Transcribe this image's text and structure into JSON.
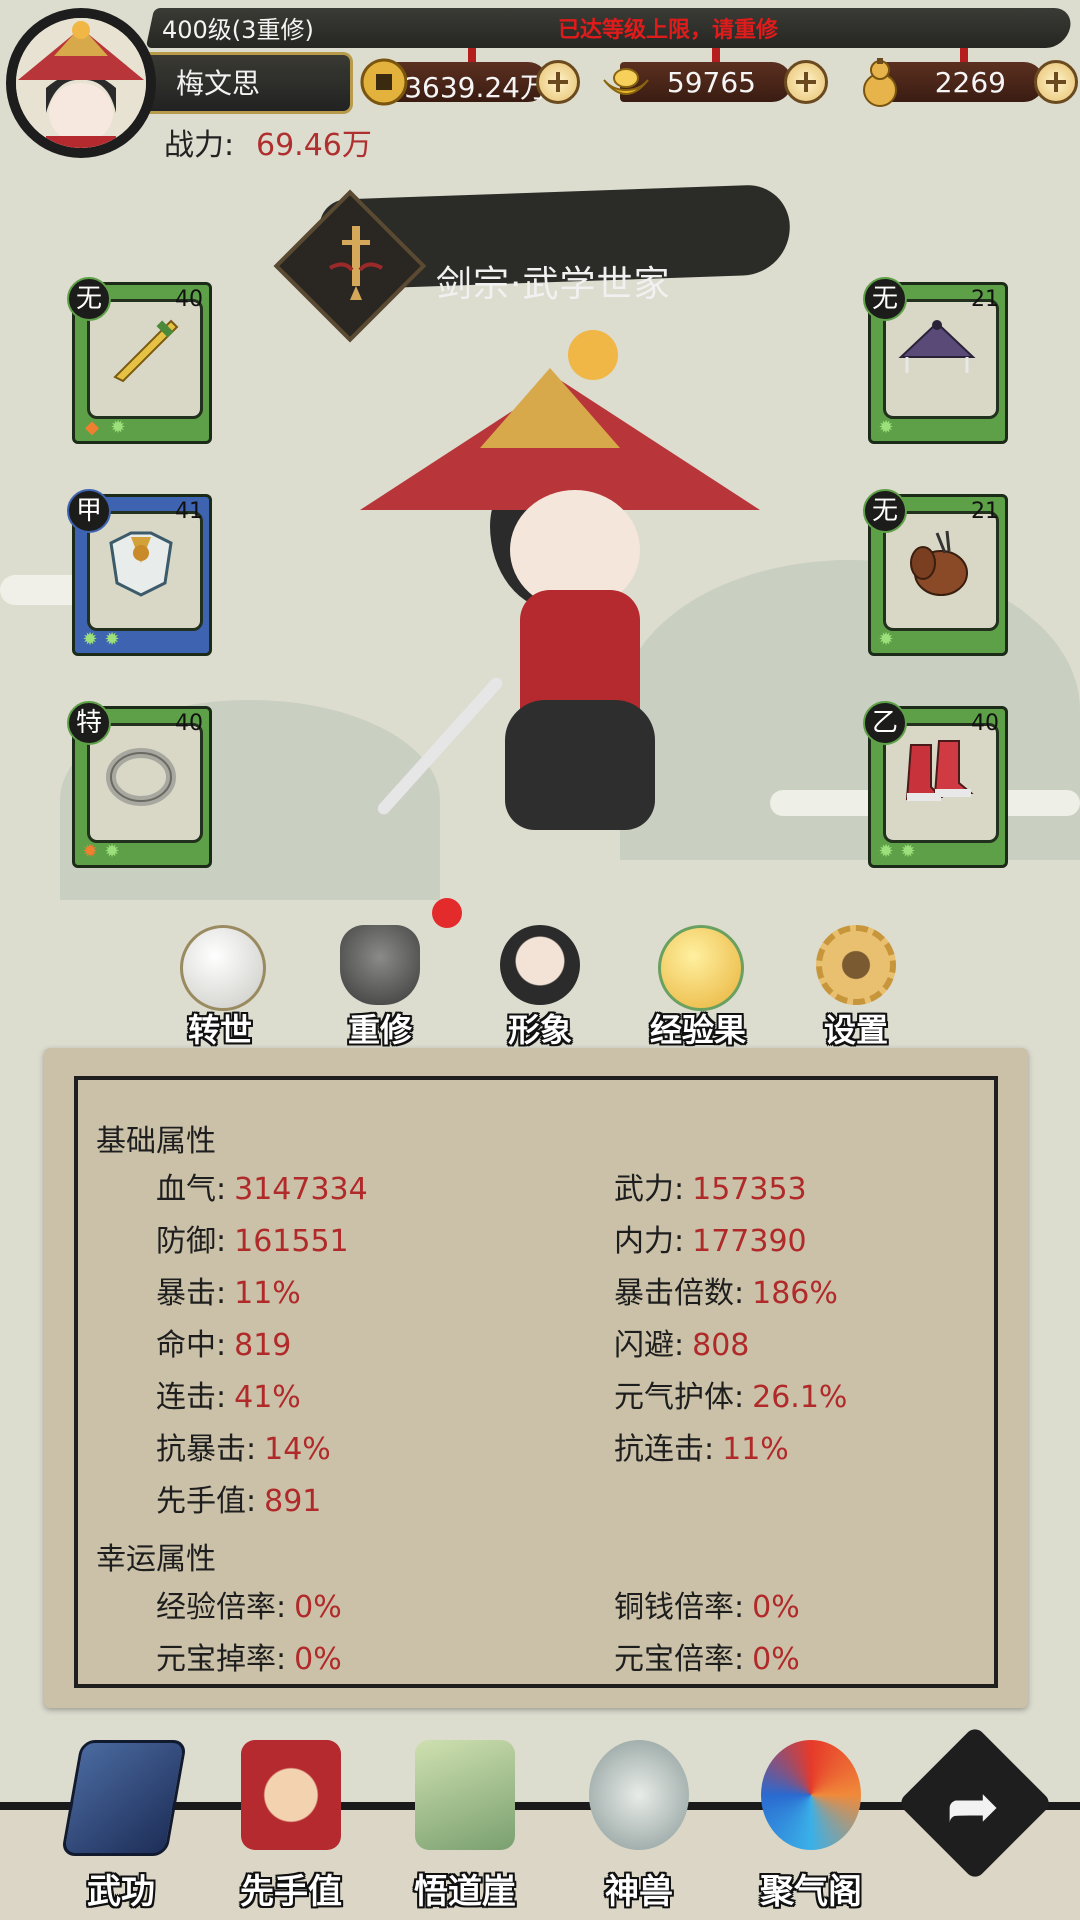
{
  "header": {
    "level_text": "400级(3重修)",
    "level_warning": "已达等级上限，请重修",
    "player_name": "梅文思",
    "power_label": "战力:",
    "power_value": "69.46万"
  },
  "currencies": [
    {
      "name": "copper-coin",
      "value": "3639.24万",
      "color": "#e0b03a"
    },
    {
      "name": "gold-ingot",
      "value": "59765",
      "color": "#f2c23a"
    },
    {
      "name": "gourd",
      "value": "2269",
      "color": "#e8b84a"
    }
  ],
  "sect": {
    "name": "剑宗·武学世家"
  },
  "equipment": {
    "left": [
      {
        "grade": "无",
        "level": "40",
        "item": "sword-icon",
        "frame": "green"
      },
      {
        "grade": "甲",
        "level": "41",
        "item": "armor-icon",
        "frame": "blue"
      },
      {
        "grade": "特",
        "level": "40",
        "item": "ring-icon",
        "frame": "green"
      }
    ],
    "right": [
      {
        "grade": "无",
        "level": "21",
        "item": "hat-icon",
        "frame": "green"
      },
      {
        "grade": "无",
        "level": "21",
        "item": "gourd-icon",
        "frame": "green"
      },
      {
        "grade": "乙",
        "level": "40",
        "item": "boots-icon",
        "frame": "green"
      }
    ]
  },
  "actions": [
    {
      "label": "转世",
      "icon": "crystal-ball-icon"
    },
    {
      "label": "重修",
      "icon": "cauldron-icon"
    },
    {
      "label": "形象",
      "icon": "appearance-icon"
    },
    {
      "label": "经验果",
      "icon": "exp-fruit-icon"
    },
    {
      "label": "设置",
      "icon": "gear-icon"
    }
  ],
  "stats": {
    "basic_title": "基础属性",
    "basic": [
      {
        "label": "血气:",
        "value": "3147334"
      },
      {
        "label": "武力:",
        "value": "157353"
      },
      {
        "label": "防御:",
        "value": "161551"
      },
      {
        "label": "内力:",
        "value": "177390"
      },
      {
        "label": "暴击:",
        "value": "11%"
      },
      {
        "label": "暴击倍数:",
        "value": "186%"
      },
      {
        "label": "命中:",
        "value": "819"
      },
      {
        "label": "闪避:",
        "value": "808"
      },
      {
        "label": "连击:",
        "value": "41%"
      },
      {
        "label": "元气护体:",
        "value": "26.1%"
      },
      {
        "label": "抗暴击:",
        "value": "14%"
      },
      {
        "label": "抗连击:",
        "value": "11%"
      },
      {
        "label": "先手值:",
        "value": "891"
      }
    ],
    "luck_title": "幸运属性",
    "luck": [
      {
        "label": "经验倍率:",
        "value": "0%"
      },
      {
        "label": "铜钱倍率:",
        "value": "0%"
      },
      {
        "label": "元宝掉率:",
        "value": "0%"
      },
      {
        "label": "元宝倍率:",
        "value": "0%"
      }
    ]
  },
  "nav": [
    {
      "label": "武功",
      "icon": "martial-arts-book-icon"
    },
    {
      "label": "先手值",
      "icon": "hand-gesture-icon"
    },
    {
      "label": "悟道崖",
      "icon": "cliff-icon"
    },
    {
      "label": "神兽",
      "icon": "beast-icon"
    },
    {
      "label": "聚气阁",
      "icon": "qi-swirl-icon"
    }
  ],
  "colors": {
    "accent_red": "#b02a2a",
    "warning_red": "#e01b1b"
  }
}
